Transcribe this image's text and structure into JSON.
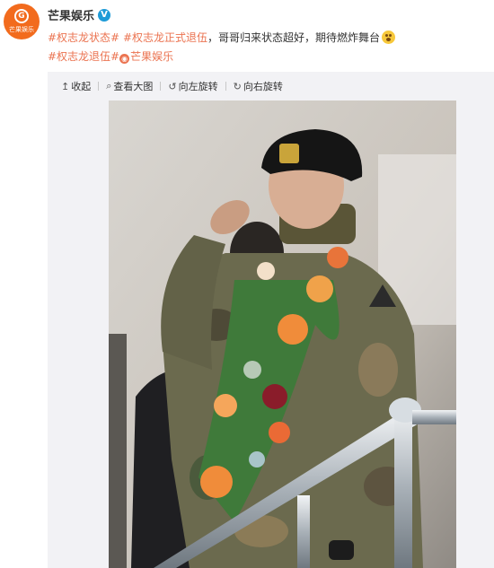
{
  "account": {
    "avatar_text": "芒果娱乐",
    "username": "芒果娱乐",
    "verified_badge": "V"
  },
  "post": {
    "tag1": "#权志龙状态#",
    "tag2": "#权志龙正式退伍",
    "text": "，哥哥归来状态超好，期待燃炸舞台",
    "emoji": "awkward-smile-emoji",
    "tag3": "#权志龙退伍#",
    "link_label": "芒果娱乐"
  },
  "toolbar": {
    "collapse": "收起",
    "view_large": "查看大图",
    "rotate_left": "向左旋转",
    "rotate_right": "向右旋转"
  },
  "colors": {
    "brand_orange": "#f26b1d",
    "tag_color": "#eb7350",
    "verified_blue": "#1e9bd7",
    "media_bg": "#f2f2f5"
  },
  "photo": {
    "subject": "soldier in camouflage uniform and black beret saluting, wearing flower garland, beside metal railing"
  }
}
